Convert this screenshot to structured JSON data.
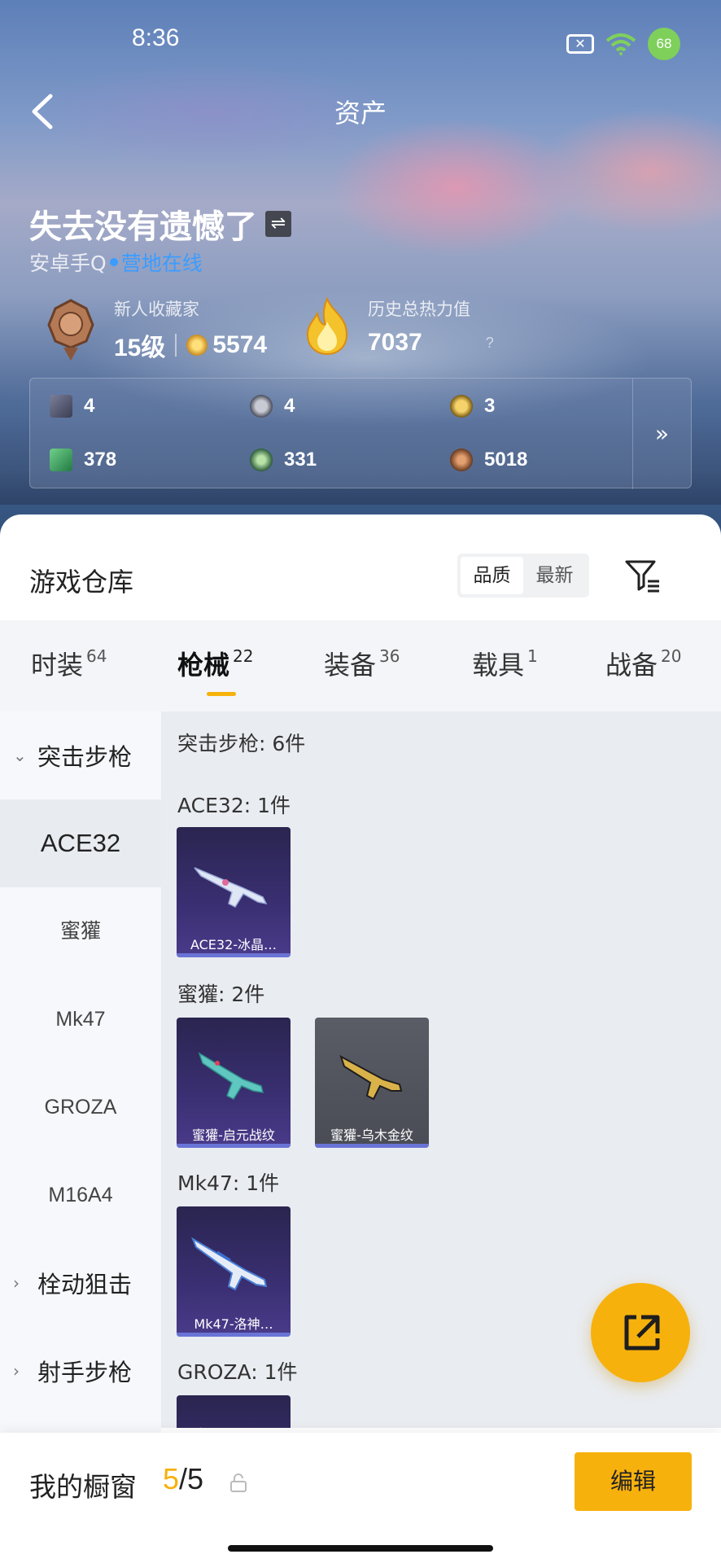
{
  "status_bar": {
    "time": "8:36",
    "battery": "68"
  },
  "header": {
    "title": "资产"
  },
  "profile": {
    "name": "失去没有遗憾了",
    "platform": "安卓手Q",
    "online_status": "营地在线",
    "rank_title": "新人收藏家",
    "level": "15级",
    "coins": "5574",
    "heat_title": "历史总热力值",
    "heat_value": "7037",
    "help": "?"
  },
  "stats": [
    {
      "icon": "card-icon",
      "value": "4"
    },
    {
      "icon": "silver-medal-icon",
      "value": "4"
    },
    {
      "icon": "gold-badge-icon",
      "value": "3"
    },
    {
      "icon": "ticket-icon",
      "value": "378"
    },
    {
      "icon": "green-orb-icon",
      "value": "331"
    },
    {
      "icon": "bronze-coin-icon",
      "value": "5018"
    }
  ],
  "stats_more": "»",
  "warehouse": {
    "title": "游戏仓库",
    "sort_options": [
      "品质",
      "最新"
    ],
    "sort_active": 0
  },
  "tabs": [
    {
      "label": "时装",
      "count": "64"
    },
    {
      "label": "枪械",
      "count": "22"
    },
    {
      "label": "装备",
      "count": "36"
    },
    {
      "label": "载具",
      "count": "1"
    },
    {
      "label": "战备",
      "count": "20"
    }
  ],
  "active_tab": 1,
  "sidebar": {
    "groups": [
      {
        "label": "突击步枪",
        "expanded": true
      },
      {
        "label": "栓动狙击",
        "expanded": false
      },
      {
        "label": "射手步枪",
        "expanded": false
      }
    ],
    "items": [
      "ACE32",
      "蜜獾",
      "Mk47",
      "GROZA",
      "M16A4"
    ],
    "active_item": 0
  },
  "content": {
    "summary": "突击步枪: 6件",
    "sections": [
      {
        "label": "ACE32: 1件",
        "cards": [
          {
            "name": "ACE32-冰晶…",
            "style": "purple"
          }
        ]
      },
      {
        "label": "蜜獾: 2件",
        "cards": [
          {
            "name": "蜜獾-启元战纹",
            "style": "purple"
          },
          {
            "name": "蜜獾-乌木金纹",
            "style": "gray"
          }
        ]
      },
      {
        "label": "Mk47: 1件",
        "cards": [
          {
            "name": "Mk47-洛神…",
            "style": "purple"
          }
        ]
      },
      {
        "label": "GROZA: 1件",
        "cards": [
          {
            "name": "",
            "style": "purple"
          }
        ]
      }
    ]
  },
  "showcase": {
    "label": "我的橱窗",
    "current": "5",
    "total": "/5",
    "edit_label": "编辑"
  },
  "colors": {
    "accent": "#f7b10c",
    "online": "#3b9cff",
    "card_purple": "#3a2f72"
  }
}
